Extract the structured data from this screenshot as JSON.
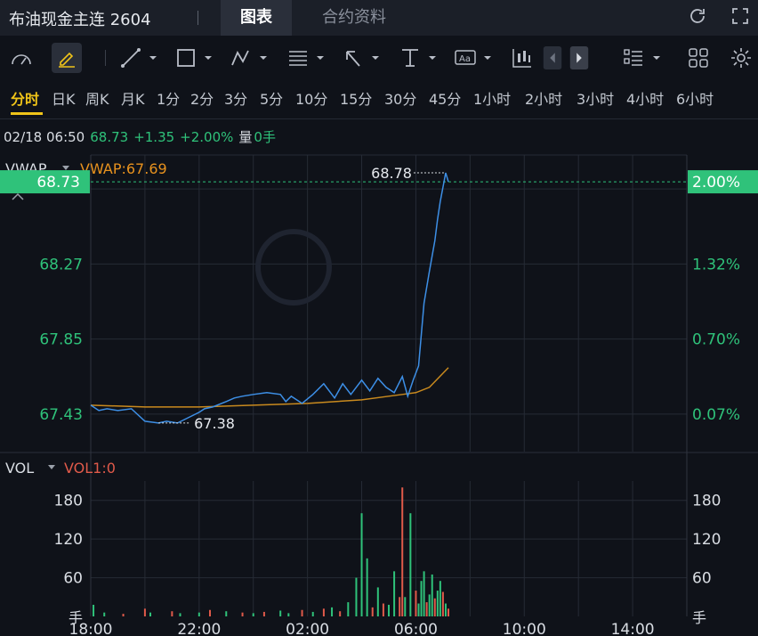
{
  "header": {
    "title": "布油现金主连 2604",
    "tabs": [
      {
        "label": "图表",
        "active": true
      },
      {
        "label": "合约资料",
        "active": false
      }
    ],
    "icons": [
      "refresh-icon",
      "fullscreen-icon"
    ]
  },
  "toolbar": {
    "tools": [
      "gauge-icon",
      "pencil-icon",
      "line-draw-icon",
      "rectangle-icon",
      "pattern-icon",
      "fib-icon",
      "arrow-icon",
      "measure-icon",
      "text-icon",
      "candle-icon",
      "prev-icon",
      "next-icon",
      "layout-icon",
      "grid-icon",
      "settings-icon"
    ]
  },
  "periods": [
    "分时",
    "日K",
    "周K",
    "月K",
    "1分",
    "2分",
    "3分",
    "5分",
    "10分",
    "15分",
    "30分",
    "45分",
    "1小时",
    "2小时",
    "3小时",
    "4小时",
    "6小时"
  ],
  "active_period": "分时",
  "quote": {
    "datetime": "02/18 06:50",
    "price": "68.73",
    "change": "+1.35",
    "change_pct": "+2.00%",
    "volume_label": "量",
    "volume": "0手"
  },
  "colors": {
    "up": "#2fc27a",
    "down": "#e05a4a",
    "price_line": "#3d8fe6",
    "vwap_line": "#c98a1e",
    "accent": "#f0c419"
  },
  "chart_data": [
    {
      "type": "line",
      "indicator_label": "VWAP",
      "indicator_value": "VWAP:67.69",
      "current_price": "68.73",
      "current_pct": "2.00%",
      "high_label": "68.78",
      "low_label": "67.38",
      "y_ticks": [
        "68.27",
        "67.85",
        "67.43"
      ],
      "y_ticks_pct": [
        "1.32%",
        "0.70%",
        "0.07%"
      ],
      "x_ticks": [
        "18:00",
        "22:00",
        "02:00",
        "06:00",
        "10:00",
        "14:00"
      ],
      "ylim": [
        67.22,
        68.88
      ],
      "x_range_hours": [
        0,
        22
      ],
      "series": [
        {
          "name": "price",
          "x": [
            0,
            0.3,
            0.6,
            1.0,
            1.5,
            2.0,
            2.5,
            2.8,
            3.2,
            3.6,
            4.0,
            4.2,
            4.5,
            5.0,
            5.3,
            5.6,
            6.0,
            6.5,
            7.0,
            7.2,
            7.4,
            7.8,
            8.2,
            8.6,
            8.8,
            9.0,
            9.3,
            9.6,
            10.0,
            10.3,
            10.6,
            10.9,
            11.2,
            11.5,
            11.7,
            11.9,
            12.1,
            12.3,
            12.5,
            12.7,
            12.8,
            12.9,
            13.0,
            13.1,
            13.2
          ],
          "values": [
            67.48,
            67.45,
            67.46,
            67.45,
            67.46,
            67.39,
            67.38,
            67.39,
            67.38,
            67.41,
            67.44,
            67.46,
            67.47,
            67.5,
            67.52,
            67.53,
            67.54,
            67.55,
            67.54,
            67.5,
            67.53,
            67.49,
            67.54,
            67.6,
            67.56,
            67.52,
            67.6,
            67.54,
            67.62,
            67.56,
            67.63,
            67.58,
            67.55,
            67.64,
            67.53,
            67.62,
            67.7,
            68.05,
            68.23,
            68.4,
            68.52,
            68.62,
            68.7,
            68.78,
            68.73
          ]
        },
        {
          "name": "VWAP",
          "x": [
            0,
            2,
            4,
            6,
            8,
            9,
            10,
            11,
            11.5,
            12,
            12.5,
            13.2
          ],
          "values": [
            67.48,
            67.47,
            67.47,
            67.48,
            67.49,
            67.5,
            67.51,
            67.53,
            67.54,
            67.55,
            67.58,
            67.69
          ]
        }
      ]
    },
    {
      "type": "bar",
      "indicator_label": "VOL",
      "indicator_value": "VOL1:0",
      "unit": "手",
      "y_ticks": [
        "180",
        "120",
        "60"
      ],
      "ylim": [
        0,
        210
      ],
      "x": [
        0.1,
        0.5,
        1.2,
        2.0,
        2.2,
        3.0,
        3.3,
        4.0,
        4.4,
        5.0,
        5.6,
        6.0,
        6.4,
        7.0,
        7.3,
        7.8,
        8.2,
        8.6,
        8.9,
        9.2,
        9.5,
        9.8,
        10.0,
        10.2,
        10.4,
        10.6,
        10.8,
        11.0,
        11.2,
        11.4,
        11.5,
        11.6,
        11.8,
        12.0,
        12.1,
        12.2,
        12.3,
        12.4,
        12.5,
        12.6,
        12.7,
        12.8,
        12.9,
        13.0,
        13.1,
        13.2
      ],
      "values": [
        18,
        6,
        4,
        12,
        6,
        8,
        5,
        6,
        10,
        8,
        6,
        5,
        7,
        9,
        5,
        10,
        7,
        12,
        14,
        8,
        22,
        60,
        160,
        90,
        14,
        45,
        20,
        18,
        70,
        30,
        200,
        30,
        160,
        40,
        20,
        55,
        70,
        22,
        34,
        65,
        28,
        40,
        55,
        38,
        20,
        12
      ],
      "colors": [
        "up",
        "up",
        "down",
        "down",
        "up",
        "down",
        "up",
        "up",
        "down",
        "up",
        "down",
        "up",
        "down",
        "up",
        "up",
        "down",
        "up",
        "down",
        "up",
        "down",
        "up",
        "up",
        "up",
        "up",
        "down",
        "up",
        "down",
        "up",
        "up",
        "down",
        "down",
        "up",
        "up",
        "down",
        "up",
        "up",
        "up",
        "down",
        "up",
        "up",
        "down",
        "up",
        "up",
        "down",
        "up",
        "down"
      ]
    }
  ]
}
